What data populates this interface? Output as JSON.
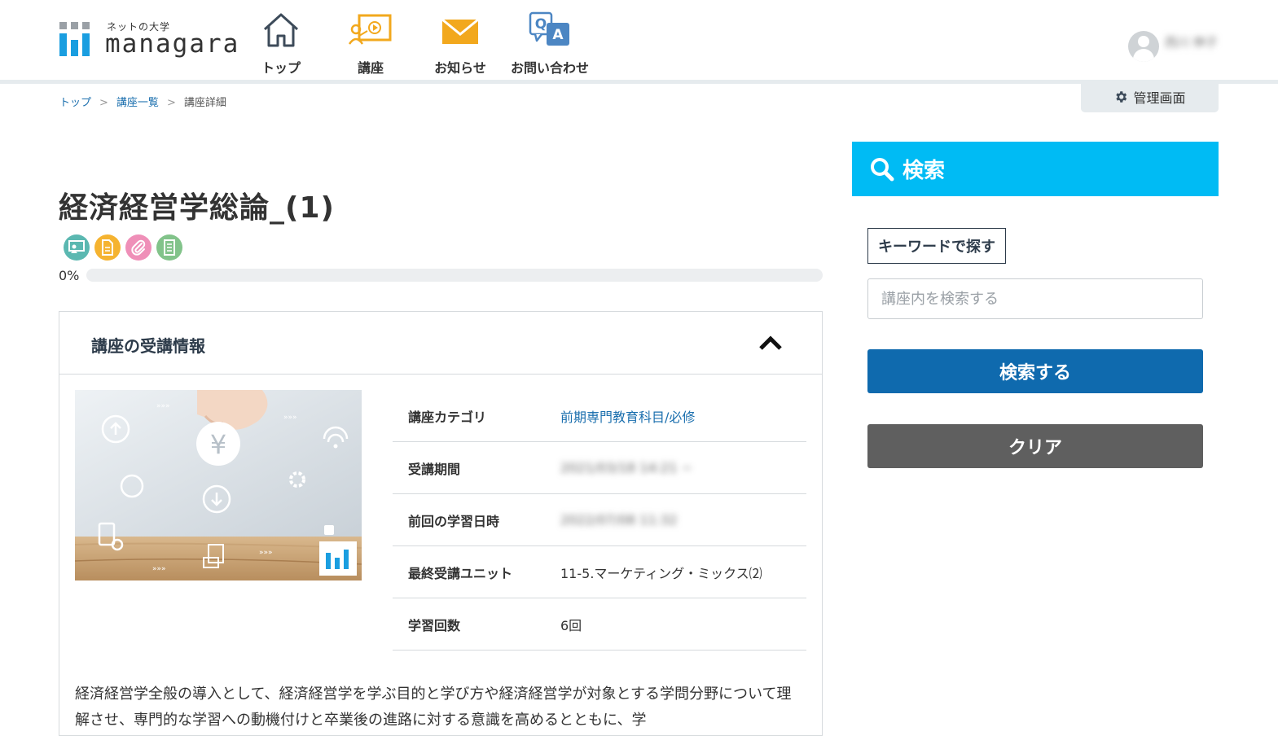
{
  "brand": {
    "tagline": "ネットの大学",
    "wordmark": "managara",
    "accent_color": "#1a9ee0"
  },
  "nav": [
    {
      "label": "トップ",
      "icon": "home-icon"
    },
    {
      "label": "講座",
      "icon": "lecture-icon"
    },
    {
      "label": "お知らせ",
      "icon": "mail-icon"
    },
    {
      "label": "お問い合わせ",
      "icon": "qa-icon"
    }
  ],
  "user": {
    "name": "西川 伸子",
    "icon": "avatar-icon"
  },
  "admin": {
    "label": "管理画面",
    "icon": "gear-icon"
  },
  "breadcrumb": {
    "items": [
      "トップ",
      "講座一覧",
      "講座詳細"
    ],
    "separator": ">"
  },
  "course": {
    "title": "経済経営学総論_(1)",
    "type_icons": [
      "video-icon",
      "document-icon",
      "attachment-icon",
      "report-icon"
    ],
    "progress": {
      "label": "0%",
      "value": 0
    }
  },
  "info_panel": {
    "title": "講座の受講情報",
    "rows": [
      {
        "label": "講座カテゴリ",
        "value": "前期専門教育科目/必修",
        "link": true
      },
      {
        "label": "受講期間",
        "value": "2021/03/18 14:21 ~",
        "blurred": true
      },
      {
        "label": "前回の学習日時",
        "value": "2022/07/08 11:32",
        "blurred": true
      },
      {
        "label": "最終受講ユニット",
        "value": "11-5.マーケティング・ミックス⑵"
      },
      {
        "label": "学習回数",
        "value": "6回"
      }
    ],
    "description": "経済経営学全般の導入として、経済経営学を学ぶ目的と学び方や経済経営学が対象とする学問分野について理解させ、専門的な学習への動機付けと卒業後の進路に対する意識を高めるとともに、学"
  },
  "sidebar": {
    "title": "検索",
    "keyword_label": "キーワードで探す",
    "search_placeholder": "講座内を検索する",
    "search_value": "",
    "search_button": "検索する",
    "clear_button": "クリア"
  }
}
